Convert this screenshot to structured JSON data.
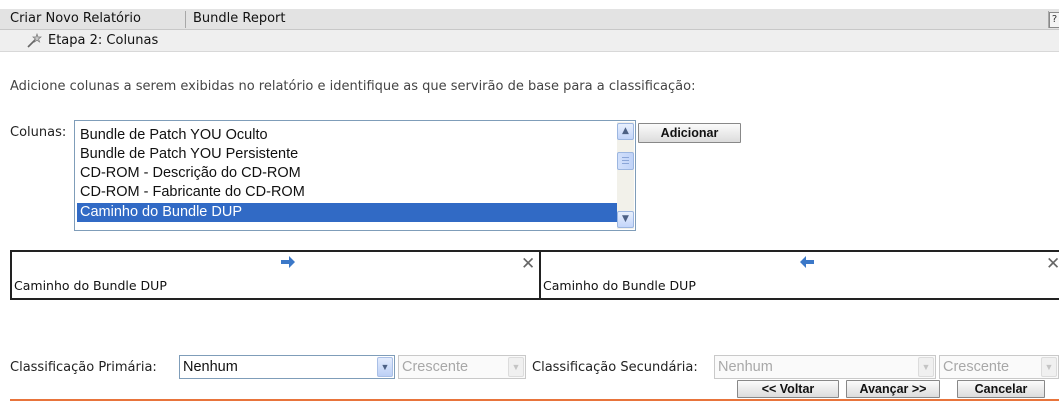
{
  "header": {
    "title": "Criar Novo Relatório",
    "subtitle": "Bundle Report",
    "help_label": "?"
  },
  "step": {
    "icon": "wand-icon",
    "title": "Etapa 2: Colunas"
  },
  "instructions": "Adicione colunas a serem exibidas no relatório e identifique as que servirão de base para a classificação:",
  "columns": {
    "label": "Colunas:",
    "items": [
      "Bundle de Patch YOU Oculto",
      "Bundle de Patch YOU Persistente",
      "CD-ROM - Descrição do CD-ROM",
      "CD-ROM - Fabricante do CD-ROM",
      "Caminho do Bundle DUP"
    ],
    "selected": "Caminho do Bundle DUP",
    "add_button": "Adicionar"
  },
  "sort_panels": {
    "primary_value": "Caminho do Bundle DUP",
    "secondary_value": "Caminho do Bundle DUP"
  },
  "sorting": {
    "primary_label": "Classificação Primária:",
    "primary_value": "Nenhum",
    "primary_order": "Crescente",
    "secondary_label": "Classificação Secundária:",
    "secondary_value": "Nenhum",
    "secondary_order": "Crescente"
  },
  "footer": {
    "back": "<< Voltar",
    "next": "Avançar >>",
    "cancel": "Cancelar"
  },
  "colors": {
    "selection": "#316ac5",
    "divider": "#e8743b",
    "arrow": "#3b78c8"
  }
}
